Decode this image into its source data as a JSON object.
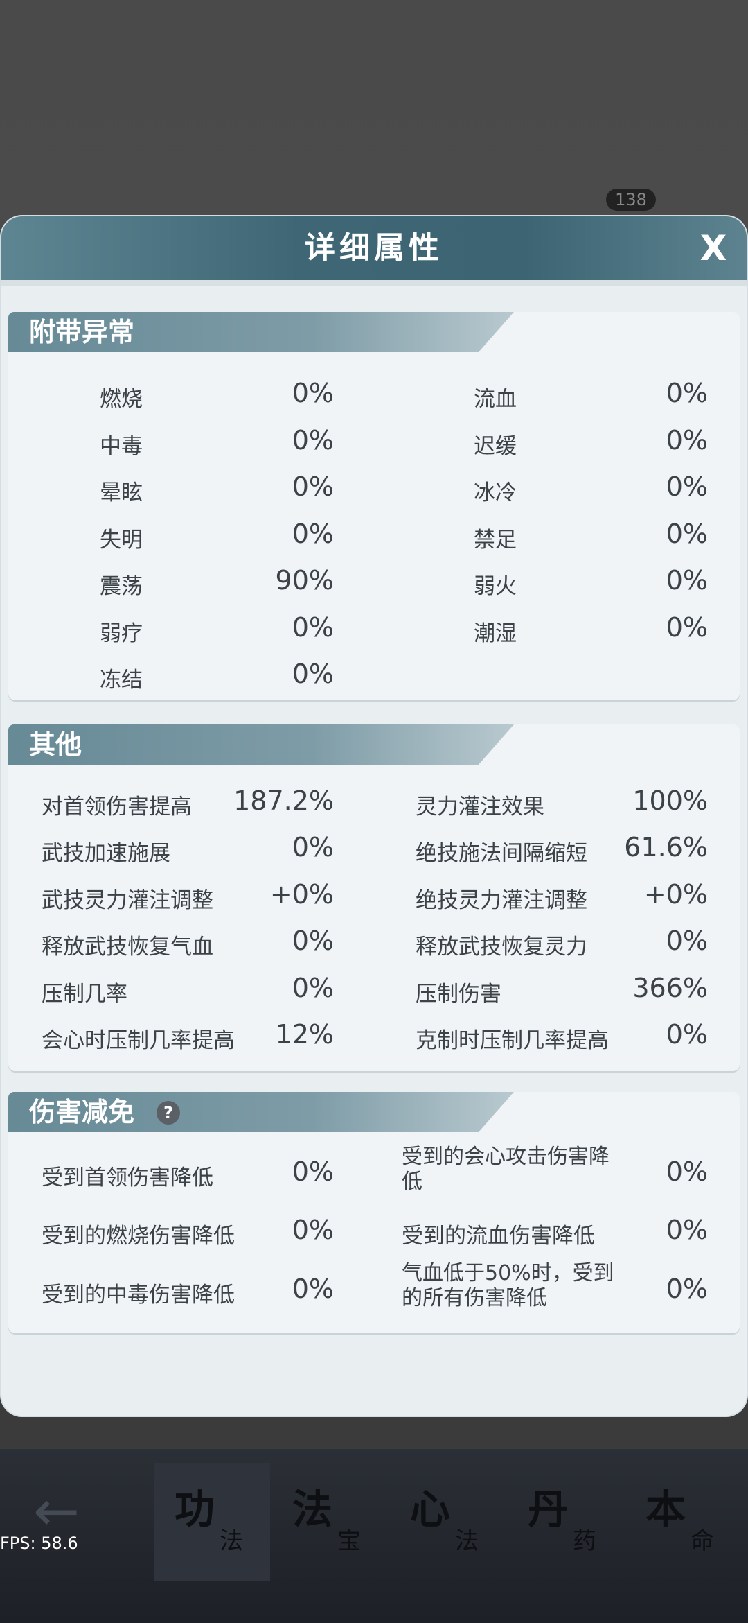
{
  "background": {
    "chip": "138"
  },
  "bottom_nav": {
    "tabs": [
      {
        "big": "功",
        "small": "法"
      },
      {
        "big": "法",
        "small": "宝"
      },
      {
        "big": "心",
        "small": "法"
      },
      {
        "big": "丹",
        "small": "药"
      },
      {
        "big": "本",
        "small": "命"
      }
    ],
    "fps": "FPS: 58.6"
  },
  "modal": {
    "title": "详细属性",
    "close_label": "X"
  },
  "section1": {
    "title": "附带异常",
    "left": [
      {
        "label": "燃烧",
        "value": "0%"
      },
      {
        "label": "中毒",
        "value": "0%"
      },
      {
        "label": "晕眩",
        "value": "0%"
      },
      {
        "label": "失明",
        "value": "0%"
      },
      {
        "label": "震荡",
        "value": "90%"
      },
      {
        "label": "弱疗",
        "value": "0%"
      },
      {
        "label": "冻结",
        "value": "0%"
      }
    ],
    "right": [
      {
        "label": "流血",
        "value": "0%"
      },
      {
        "label": "迟缓",
        "value": "0%"
      },
      {
        "label": "冰冷",
        "value": "0%"
      },
      {
        "label": "禁足",
        "value": "0%"
      },
      {
        "label": "弱火",
        "value": "0%"
      },
      {
        "label": "潮湿",
        "value": "0%"
      }
    ]
  },
  "section2": {
    "title": "其他",
    "left": [
      {
        "label": "对首领伤害提高",
        "value": "187.2%"
      },
      {
        "label": "武技加速施展",
        "value": "0%"
      },
      {
        "label": "武技灵力灌注调整",
        "value": "+0%"
      },
      {
        "label": "释放武技恢复气血",
        "value": "0%"
      },
      {
        "label": "压制几率",
        "value": "0%"
      },
      {
        "label": "会心时压制几率提高",
        "value": "12%"
      }
    ],
    "right": [
      {
        "label": "灵力灌注效果",
        "value": "100%"
      },
      {
        "label": "绝技施法间隔缩短",
        "value": "61.6%"
      },
      {
        "label": "绝技灵力灌注调整",
        "value": "+0%"
      },
      {
        "label": "释放武技恢复灵力",
        "value": "0%"
      },
      {
        "label": "压制伤害",
        "value": "366%"
      },
      {
        "label": "克制时压制几率提高",
        "value": "0%"
      }
    ]
  },
  "section3": {
    "title": "伤害减免",
    "help": "?",
    "left": [
      {
        "label": "受到首领伤害降低",
        "value": "0%"
      },
      {
        "label": "受到的燃烧伤害降低",
        "value": "0%"
      },
      {
        "label": "受到的中毒伤害降低",
        "value": "0%"
      }
    ],
    "right": [
      {
        "label": "受到的会心攻击伤害降低",
        "value": "0%"
      },
      {
        "label": "受到的流血伤害降低",
        "value": "0%"
      },
      {
        "label": "气血低于50%时，受到的所有伤害降低",
        "value": "0%"
      }
    ]
  }
}
